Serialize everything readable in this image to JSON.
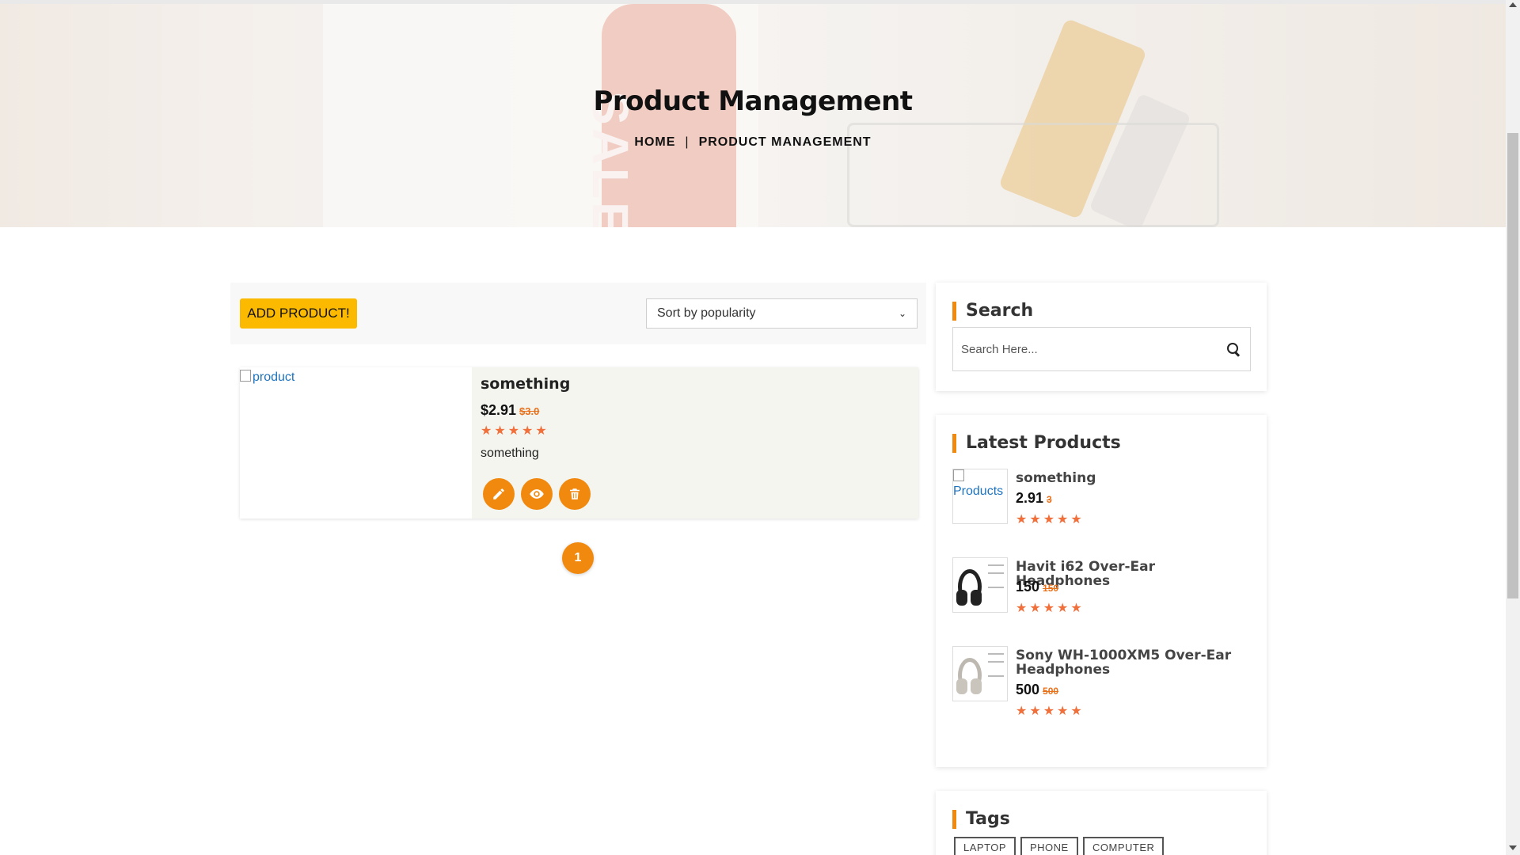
{
  "hero": {
    "title": "Product Management",
    "breadcrumb_home": "HOME",
    "breadcrumb_sep": "|",
    "breadcrumb_current": "PRODUCT MANAGEMENT",
    "tag_text": "SALE"
  },
  "toolbar": {
    "add_label": "ADD PRODUCT!",
    "sort_value": "Sort by popularity"
  },
  "products": [
    {
      "image_alt": "product",
      "name": "something",
      "price": "$2.91",
      "old_price": "$3.0",
      "rating": 5,
      "stars": "★★★★★",
      "description": "something"
    }
  ],
  "actions": {
    "edit_icon": "pencil-icon",
    "view_icon": "eye-icon",
    "delete_icon": "trash-icon"
  },
  "pagination": {
    "current": "1"
  },
  "sidebar": {
    "search_title": "Search",
    "search_placeholder": "Search Here...",
    "latest_title": "Latest Products",
    "latest": [
      {
        "image_alt": "Products",
        "name": "something",
        "price": "2.91",
        "old_price": "3",
        "stars": "★★★★★"
      },
      {
        "name": "Havit i62 Over-Ear Headphones",
        "price": "150",
        "old_price": "150",
        "stars": "★★★★★"
      },
      {
        "name": "Sony WH-1000XM5 Over-Ear Headphones",
        "price": "500",
        "old_price": "500",
        "stars": "★★★★★"
      }
    ],
    "tags_title": "Tags",
    "tags": [
      "LAPTOP",
      "PHONE",
      "COMPUTER"
    ]
  },
  "colors": {
    "accent": "#f0890e",
    "add_button": "#fbba00",
    "star": "#f06f3a",
    "link": "#1e73be"
  }
}
